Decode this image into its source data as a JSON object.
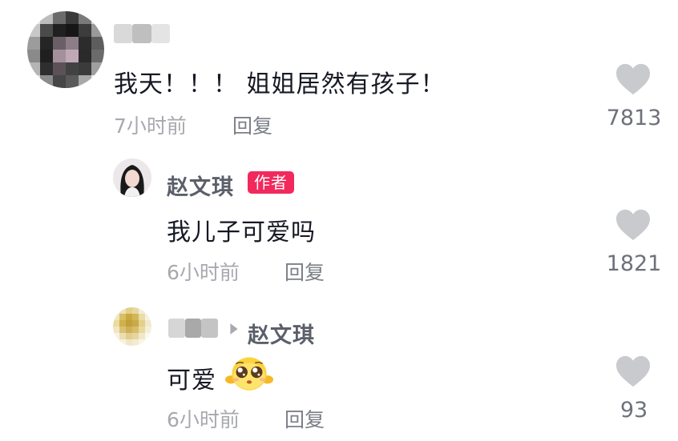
{
  "comments": [
    {
      "text": "我天！！！ 姐姐居然有孩子！",
      "time": "7小时前",
      "reply_label": "回复",
      "likes": "7813"
    },
    {
      "author": "赵文琪",
      "author_badge": "作者",
      "text": "我儿子可爱吗",
      "time": "6小时前",
      "reply_label": "回复",
      "likes": "1821"
    },
    {
      "reply_to": "赵文琪",
      "text": "可爱",
      "emoji": "pleading-face-emoji",
      "time": "6小时前",
      "reply_label": "回复",
      "likes": "93"
    }
  ],
  "colors": {
    "badge": "#f2295c",
    "heart": "#c9cacd",
    "meta": "#a7a9ae"
  },
  "icons": [
    "heart-icon",
    "reply-arrow-icon",
    "pleading-face-emoji"
  ]
}
